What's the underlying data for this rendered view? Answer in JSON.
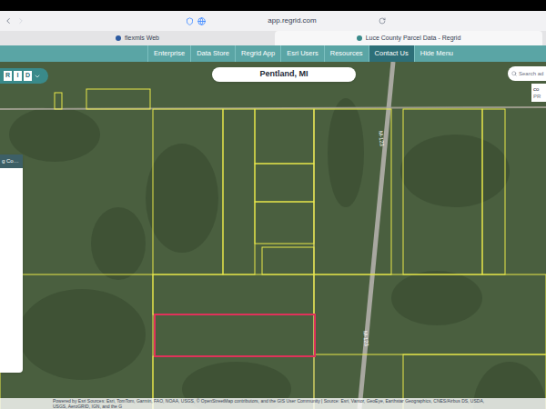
{
  "browser": {
    "url": "app.regrid.com",
    "tabs": [
      {
        "label": "flexmls Web",
        "selected": false
      },
      {
        "label": "Luce County Parcel Data - Regrid",
        "selected": true
      }
    ]
  },
  "nav": [
    {
      "label": "Enterprise",
      "selected": false
    },
    {
      "label": "Data Store",
      "selected": false
    },
    {
      "label": "Regrid App",
      "selected": false
    },
    {
      "label": "Esri Users",
      "selected": false
    },
    {
      "label": "Resources",
      "selected": false
    },
    {
      "label": "Contact Us",
      "selected": true
    },
    {
      "label": "Hide Menu",
      "selected": false
    }
  ],
  "app": {
    "logo": "RID",
    "search": "Pentland, MI",
    "search_right": "Search ad",
    "side_panel_title": "g Co…",
    "corner_box": [
      "co",
      "PR"
    ]
  },
  "map": {
    "road_labels": [
      "M-123",
      "M-123"
    ],
    "parcels": [
      {
        "selected": false
      },
      {
        "selected": false
      },
      {
        "selected": false
      },
      {
        "selected": false
      },
      {
        "selected": false
      },
      {
        "selected": false
      },
      {
        "selected": false
      },
      {
        "selected": false
      },
      {
        "selected": false
      },
      {
        "selected": false
      },
      {
        "selected": false
      },
      {
        "selected": true
      },
      {
        "selected": false
      },
      {
        "selected": false
      },
      {
        "selected": false
      },
      {
        "selected": false
      },
      {
        "selected": false
      }
    ],
    "attribution": "Powered by Esri Sources: Esri, TomTom, Garmin, FAO, NOAA, USGS, © OpenStreetMap contributors, and the GIS User Community | Source: Esri, Vantor, GeoEye, Earthstar Geographics, CNES/Airbus DS, USDA, USGS, AeroGRID, IGN, and the G"
  }
}
